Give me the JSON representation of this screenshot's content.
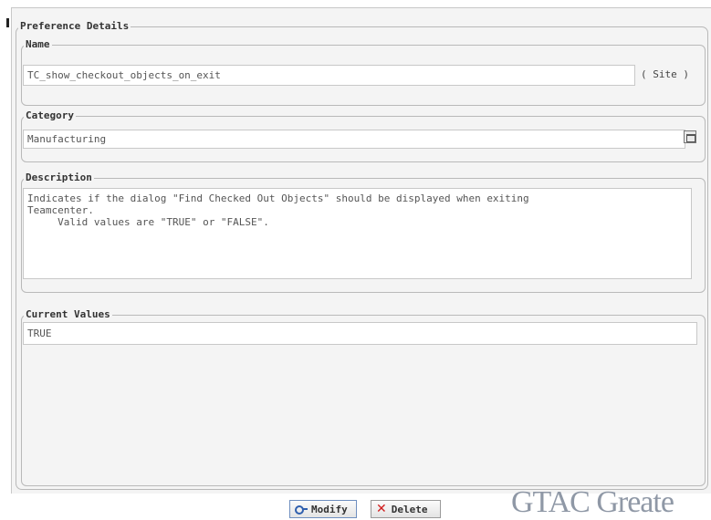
{
  "preference_details": {
    "title": "Preference Details",
    "name": {
      "label": "Name",
      "value": "TC_show_checkout_objects_on_exit",
      "scope": "( Site )"
    },
    "category": {
      "label": "Category",
      "value": "Manufacturing",
      "button_icon": "select-icon"
    },
    "description": {
      "label": "Description",
      "text": "Indicates if the dialog \"Find Checked Out Objects\" should be displayed when exiting\nTeamcenter.\n     Valid values are \"TRUE\" or \"FALSE\"."
    },
    "current_values": {
      "label": "Current Values",
      "values": [
        "TRUE"
      ]
    }
  },
  "buttons": {
    "modify": {
      "label": "Modify",
      "icon": "key-icon"
    },
    "delete": {
      "label": "Delete",
      "icon": "delete-x-icon"
    }
  },
  "watermark": "GTAC Greate"
}
